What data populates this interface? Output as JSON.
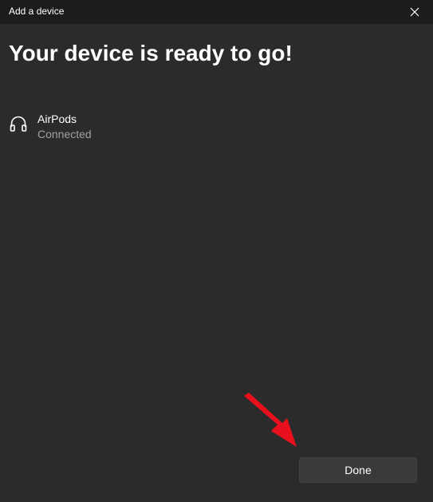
{
  "window": {
    "title": "Add a device"
  },
  "heading": "Your device is ready to go!",
  "device": {
    "name": "AirPods",
    "status": "Connected",
    "icon": "headphones-icon"
  },
  "actions": {
    "done_label": "Done"
  },
  "colors": {
    "background": "#2b2b2b",
    "titlebar": "#1c1c1c",
    "button": "#3a3a3a",
    "secondary_text": "#a0a0a0",
    "annotation_arrow": "#e8101c"
  }
}
